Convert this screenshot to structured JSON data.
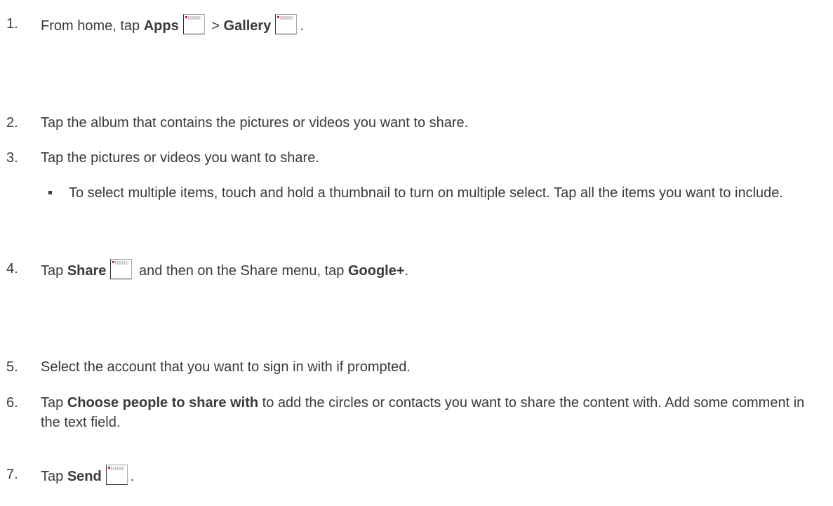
{
  "steps": [
    {
      "num": "1.",
      "pre": "From home, tap ",
      "b1": "Apps",
      "mid": " > ",
      "b2": "Gallery",
      "post": "."
    },
    {
      "num": "2.",
      "text": "Tap the album that contains the pictures or videos you want to share."
    },
    {
      "num": "3.",
      "text": "Tap the pictures or videos you want to share."
    },
    {
      "num": "4.",
      "pre": "Tap ",
      "b1": "Share",
      "mid": " and then on the Share menu, tap ",
      "b2": "Google+",
      "post": "."
    },
    {
      "num": "5.",
      "text": "Select the account that you want to sign in with if prompted."
    },
    {
      "num": "6.",
      "pre": "Tap ",
      "b1": "Choose people to share with",
      "post": " to add the circles or contacts you want to share the content with. Add some comment in the text field."
    },
    {
      "num": "7.",
      "pre": "Tap ",
      "b1": "Send",
      "post": "."
    }
  ],
  "bullet": {
    "text": "To select multiple items, touch and hold a thumbnail to turn on multiple select. Tap all the items you want to include."
  },
  "icons": {
    "apps": "apps-icon",
    "gallery": "gallery-icon",
    "share": "share-icon",
    "send": "send-icon"
  }
}
